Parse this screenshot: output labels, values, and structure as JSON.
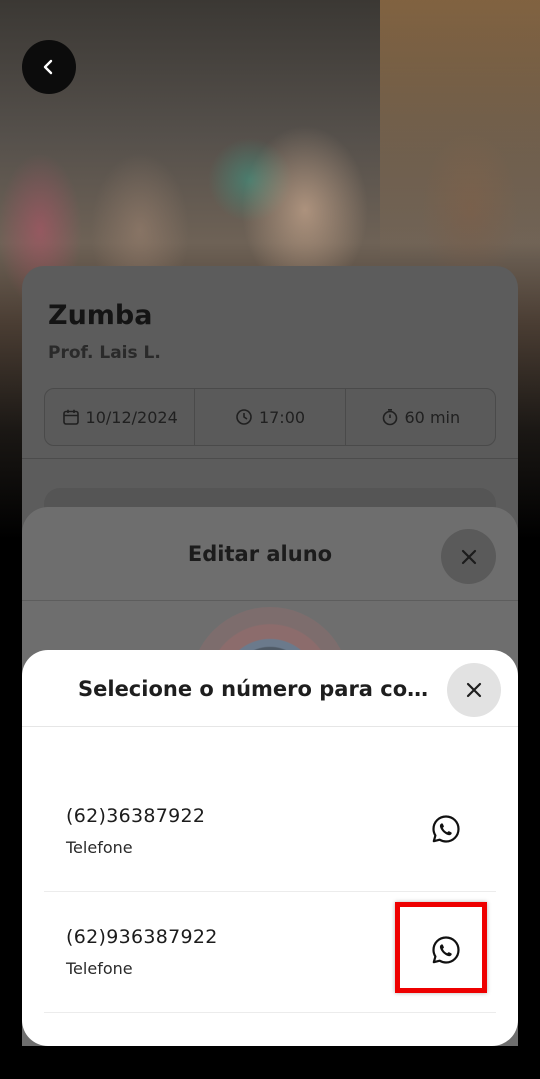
{
  "header": {
    "back_icon": "chevron-left-icon"
  },
  "class_card": {
    "title": "Zumba",
    "instructor": "Prof. Lais L.",
    "date": "10/12/2024",
    "time": "17:00",
    "duration": "60 min",
    "date_icon": "calendar-icon",
    "time_icon": "clock-icon",
    "duration_icon": "stopwatch-icon"
  },
  "edit_sheet": {
    "title": "Editar aluno",
    "close_icon": "close-icon"
  },
  "contact_sheet": {
    "title": "Selecione o número para contato",
    "close_icon": "close-icon",
    "numbers": [
      {
        "number": "(62)36387922",
        "type": "Telefone",
        "action_icon": "whatsapp-icon"
      },
      {
        "number": "(62)936387922",
        "type": "Telefone",
        "action_icon": "whatsapp-icon"
      }
    ]
  },
  "colors": {
    "highlight": "#ee0000",
    "sheet_background": "#ffffff"
  }
}
